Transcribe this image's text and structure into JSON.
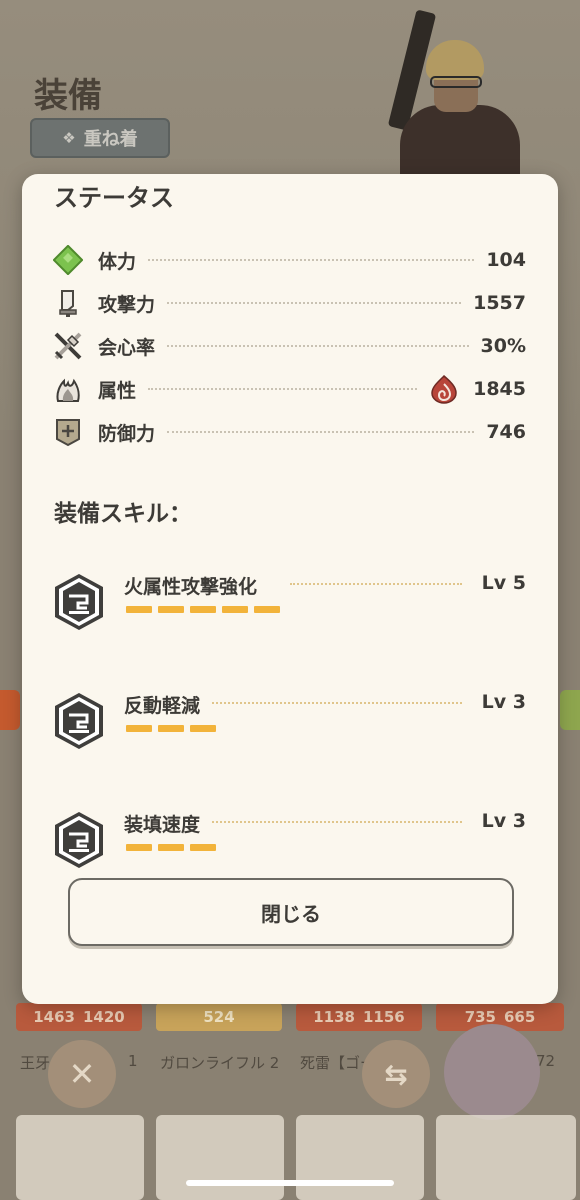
{
  "background": {
    "title": "装備",
    "layer_button_label": "重ね着",
    "card_strips": [
      {
        "a": "1463",
        "b": "1420"
      },
      {
        "a": "524",
        "b": ""
      },
      {
        "a": "1138",
        "b": "1156"
      },
      {
        "a": "735",
        "b": "665"
      }
    ],
    "names": [
      "王牙",
      "1",
      "ガロンライフル 2",
      "死雷【ゴー",
      "72"
    ]
  },
  "modal": {
    "status_title": "ステータス",
    "stats": [
      {
        "icon": "health-diamond-icon",
        "label": "体力",
        "value": "104"
      },
      {
        "icon": "attack-blade-icon",
        "label": "攻撃力",
        "value": "1557"
      },
      {
        "icon": "affinity-crossed-icon",
        "label": "会心率",
        "value": "30%"
      },
      {
        "icon": "element-fire-icon",
        "label": "属性",
        "value": "1845",
        "element_icon": "fire-element-icon"
      },
      {
        "icon": "defense-shield-icon",
        "label": "防御力",
        "value": "746"
      }
    ],
    "skills_title": "装備スキル：",
    "skills": [
      {
        "name": "火属性攻撃強化",
        "level_text": "Lv 5",
        "level": 5
      },
      {
        "name": "反動軽減",
        "level_text": "Lv 3",
        "level": 3
      },
      {
        "name": "装填速度",
        "level_text": "Lv 3",
        "level": 3
      }
    ],
    "close_label": "閉じる"
  },
  "colors": {
    "modal_bg": "#fbf7ee",
    "level_bar": "#f2b33a",
    "health_green": "#7cc24e",
    "fire_red": "#b8453a"
  }
}
